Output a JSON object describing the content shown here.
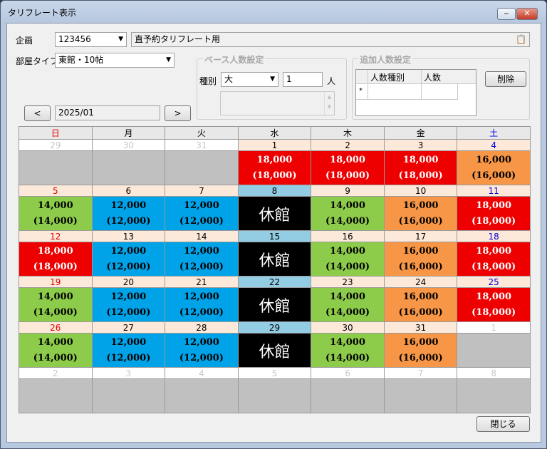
{
  "window": {
    "title": "タリフレート表示"
  },
  "form": {
    "plan_label": "企画",
    "plan_value": "123456",
    "plan_name": "直予約タリフレート用",
    "room_type_label": "部屋タイプ",
    "room_type_value": "東館・10帖",
    "base_group_title": "ベース人数設定",
    "kind_label": "種別",
    "kind_value": "大",
    "count_value": "1",
    "count_unit": "人",
    "extra_group_title": "追加人数設定",
    "grid_col1": "人数種別",
    "grid_col2": "人数",
    "grid_new_row_marker": "*",
    "delete_button": "削除",
    "prev_button": "<",
    "next_button": ">",
    "month_value": "2025/01",
    "close_button": "閉じる"
  },
  "calendar": {
    "weekdays": [
      "日",
      "月",
      "火",
      "水",
      "木",
      "金",
      "土"
    ],
    "weeks": [
      {
        "days": [
          {
            "d": "29",
            "type": "other"
          },
          {
            "d": "30",
            "type": "other"
          },
          {
            "d": "31",
            "type": "other"
          },
          {
            "d": "1",
            "type": "price",
            "price": "18,000",
            "sub": "(18,000)"
          },
          {
            "d": "2",
            "type": "price",
            "price": "18,000",
            "sub": "(18,000)"
          },
          {
            "d": "3",
            "type": "price",
            "price": "18,000",
            "sub": "(18,000)"
          },
          {
            "d": "4",
            "type": "price",
            "price": "16,000",
            "sub": "(16,000)"
          }
        ]
      },
      {
        "days": [
          {
            "d": "5",
            "type": "price",
            "price": "14,000",
            "sub": "(14,000)"
          },
          {
            "d": "6",
            "type": "price",
            "price": "12,000",
            "sub": "(12,000)"
          },
          {
            "d": "7",
            "type": "price",
            "price": "12,000",
            "sub": "(12,000)"
          },
          {
            "d": "8",
            "type": "closed",
            "label": "休館"
          },
          {
            "d": "9",
            "type": "price",
            "price": "14,000",
            "sub": "(14,000)"
          },
          {
            "d": "10",
            "type": "price",
            "price": "16,000",
            "sub": "(16,000)"
          },
          {
            "d": "11",
            "type": "price",
            "price": "18,000",
            "sub": "(18,000)"
          }
        ]
      },
      {
        "days": [
          {
            "d": "12",
            "type": "price",
            "price": "18,000",
            "sub": "(18,000)"
          },
          {
            "d": "13",
            "type": "price",
            "price": "12,000",
            "sub": "(12,000)"
          },
          {
            "d": "14",
            "type": "price",
            "price": "12,000",
            "sub": "(12,000)"
          },
          {
            "d": "15",
            "type": "closed",
            "label": "休館"
          },
          {
            "d": "16",
            "type": "price",
            "price": "14,000",
            "sub": "(14,000)"
          },
          {
            "d": "17",
            "type": "price",
            "price": "16,000",
            "sub": "(16,000)"
          },
          {
            "d": "18",
            "type": "price",
            "price": "18,000",
            "sub": "(18,000)"
          }
        ]
      },
      {
        "days": [
          {
            "d": "19",
            "type": "price",
            "price": "14,000",
            "sub": "(14,000)"
          },
          {
            "d": "20",
            "type": "price",
            "price": "12,000",
            "sub": "(12,000)"
          },
          {
            "d": "21",
            "type": "price",
            "price": "12,000",
            "sub": "(12,000)"
          },
          {
            "d": "22",
            "type": "closed",
            "label": "休館"
          },
          {
            "d": "23",
            "type": "price",
            "price": "14,000",
            "sub": "(14,000)"
          },
          {
            "d": "24",
            "type": "price",
            "price": "16,000",
            "sub": "(16,000)"
          },
          {
            "d": "25",
            "type": "price",
            "price": "18,000",
            "sub": "(18,000)"
          }
        ]
      },
      {
        "days": [
          {
            "d": "26",
            "type": "price",
            "price": "14,000",
            "sub": "(14,000)"
          },
          {
            "d": "27",
            "type": "price",
            "price": "12,000",
            "sub": "(12,000)"
          },
          {
            "d": "28",
            "type": "price",
            "price": "12,000",
            "sub": "(12,000)"
          },
          {
            "d": "29",
            "type": "closed",
            "label": "休館"
          },
          {
            "d": "30",
            "type": "price",
            "price": "14,000",
            "sub": "(14,000)"
          },
          {
            "d": "31",
            "type": "price",
            "price": "16,000",
            "sub": "(16,000)"
          },
          {
            "d": "1",
            "type": "other"
          }
        ]
      },
      {
        "days": [
          {
            "d": "2",
            "type": "other"
          },
          {
            "d": "3",
            "type": "other"
          },
          {
            "d": "4",
            "type": "other"
          },
          {
            "d": "5",
            "type": "other"
          },
          {
            "d": "6",
            "type": "other"
          },
          {
            "d": "7",
            "type": "other"
          },
          {
            "d": "8",
            "type": "other"
          }
        ]
      }
    ]
  },
  "colors": {
    "price_18000": "#ee0000",
    "price_16000": "#f79646",
    "price_14000": "#8dcb4a",
    "price_12000": "#00a3e8",
    "closed": "#000000"
  }
}
